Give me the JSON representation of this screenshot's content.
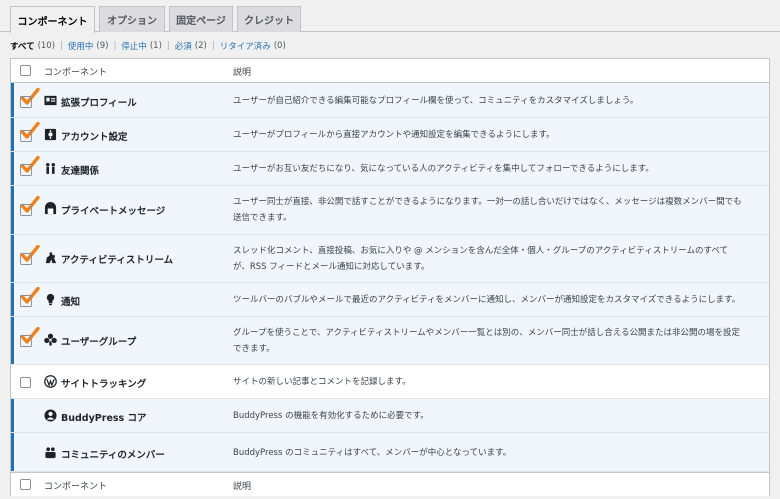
{
  "tabs": [
    "コンポーネント",
    "オプション",
    "固定ページ",
    "クレジット"
  ],
  "filters": {
    "all": {
      "label": "すべて",
      "count": "(10)"
    },
    "active": {
      "label": "使用中",
      "count": "(9)"
    },
    "inactive": {
      "label": "停止中",
      "count": "(1)"
    },
    "required": {
      "label": "必須",
      "count": "(2)"
    },
    "retired": {
      "label": "リタイア済み",
      "count": "(0)"
    },
    "separator": "|"
  },
  "header": {
    "component": "コンポーネント",
    "description": "説明"
  },
  "footer": {
    "component": "コンポーネント",
    "description": "説明"
  },
  "components": [
    {
      "name": "拡張プロフィール",
      "icon": "profile-card-icon",
      "state": "checked",
      "desc1": "ユーザーが自己紹介できる編集可能なプロフィール欄を使って、コミュニティをカスタマイズしましょう。",
      "desc2": ""
    },
    {
      "name": "アカウント設定",
      "icon": "settings-icon",
      "state": "checked",
      "desc1": "ユーザーがプロフィールから直接アカウントや通知設定を編集できるようにします。",
      "desc2": ""
    },
    {
      "name": "友達関係",
      "icon": "friends-icon",
      "state": "checked",
      "desc1": "ユーザーがお互い友だちになり、気になっている人のアクティビティを集中してフォローできるようにします。",
      "desc2": ""
    },
    {
      "name": "プライベートメッセージ",
      "icon": "messages-icon",
      "state": "checked",
      "desc1": "ユーザー同士が直接、非公開で話すことができるようになります。一対一の話し合いだけではなく、メッセージは複数メンバー間でも",
      "desc2": "送信できます。"
    },
    {
      "name": "アクティビティストリーム",
      "icon": "activity-icon",
      "state": "checked",
      "desc1": "スレッド化コメント、直接投稿、お気に入りや @ メンションを含んだ全体・個人・グループのアクティビティストリームのすべて",
      "desc2": "が、RSS フィードとメール通知に対応しています。"
    },
    {
      "name": "通知",
      "icon": "notification-bulb-icon",
      "state": "checked",
      "desc1": "ツールバーのバブルやメールで最近のアクティビティをメンバーに通知し、メンバーが通知設定をカスタマイズできるようにします。",
      "desc2": ""
    },
    {
      "name": "ユーザーグループ",
      "icon": "groups-icon",
      "state": "checked",
      "desc1": "グループを使うことで、アクティビティストリームやメンバー一覧とは別の、メンバー同士が話し合える公開または非公開の場を設定",
      "desc2": "できます。"
    },
    {
      "name": "サイトトラッキング",
      "icon": "wordpress-icon",
      "state": "unchecked",
      "desc1": "サイトの新しい記事とコメントを記録します。",
      "desc2": ""
    },
    {
      "name": "BuddyPress コア",
      "icon": "buddypress-icon",
      "state": "required",
      "desc1": "BuddyPress の機能を有効化するために必要です。",
      "desc2": ""
    },
    {
      "name": "コミュニティのメンバー",
      "icon": "members-icon",
      "state": "required",
      "desc1": "BuddyPress のコミュニティはすべて、メンバーが中心となっています。",
      "desc2": ""
    }
  ],
  "colors": {
    "accent": "#2271b1",
    "check": "#f0821e",
    "active_bg": "#f0f6fc"
  }
}
